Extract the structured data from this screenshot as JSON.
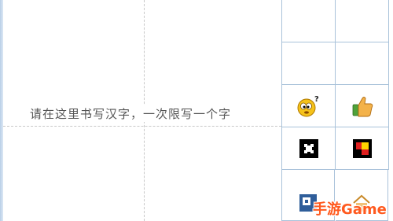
{
  "handwriting_pad": {
    "prompt": "请在这里书写汉字，一次限写一个字"
  },
  "symbol_palette": {
    "cells": [
      {
        "icon": "empty"
      },
      {
        "icon": "empty"
      },
      {
        "icon": "empty"
      },
      {
        "icon": "empty"
      },
      {
        "icon": "confused-face-icon"
      },
      {
        "icon": "thumbs-up-icon"
      },
      {
        "icon": "black-square-icon"
      },
      {
        "icon": "red-yellow-square-icon"
      },
      {
        "icon": "blue-square-icon"
      },
      {
        "icon": "house-icon"
      }
    ]
  },
  "watermark": {
    "text": "手游Game"
  },
  "colors": {
    "grid_line": "#a9c2da",
    "guide_line": "#c8c8c8",
    "watermark": "#ff5a1f"
  }
}
